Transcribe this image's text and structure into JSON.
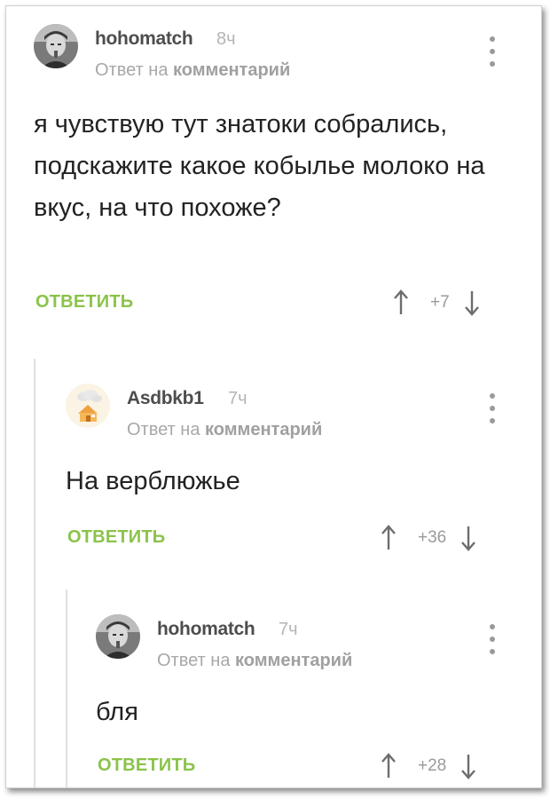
{
  "comments": [
    {
      "author": "hohomatch",
      "time": "8ч",
      "reply_prefix": "Ответ на",
      "reply_target": "комментарий",
      "text": "я чувствую тут знатоки собрались, подскажите какое кобылье молоко на вкус, на что похоже?",
      "reply_label": "ОТВЕТИТЬ",
      "score": "+7",
      "avatar_icon": "avatar-boy-photo"
    },
    {
      "author": "Asdbkb1",
      "time": "7ч",
      "reply_prefix": "Ответ на",
      "reply_target": "комментарий",
      "text": "На верблюжье",
      "reply_label": "ОТВЕТИТЬ",
      "score": "+36",
      "avatar_icon": "avatar-cottage-cloud"
    },
    {
      "author": "hohomatch",
      "time": "7ч",
      "reply_prefix": "Ответ на",
      "reply_target": "комментарий",
      "text": "бля",
      "reply_label": "ОТВЕТИТЬ",
      "score": "+28",
      "avatar_icon": "avatar-boy-photo"
    }
  ],
  "colors": {
    "accent": "#8bc34a",
    "muted": "#a8a8a8",
    "thread_line": "#e0e0e0"
  }
}
